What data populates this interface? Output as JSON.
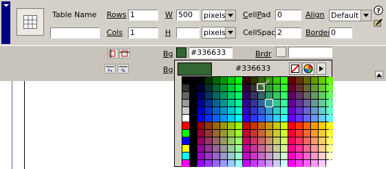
{
  "inspector": {
    "table_name_label": "Table Name",
    "table_name_value": "",
    "rows_label": "Rows",
    "rows_value": "1",
    "cols_label": "Cols",
    "cols_value": "1",
    "width_label": "W",
    "width_value": "500",
    "width_unit": "pixels",
    "height_label": "H",
    "height_value": "",
    "height_unit": "pixels",
    "cellpad_label": "CellPad",
    "cellpad_value": "0",
    "cellspace_label": "CellSpace",
    "cellspace_value": "2",
    "align_label": "Align",
    "align_value": "Default",
    "border_label": "Border",
    "border_value": "0",
    "bg_label": "Bg",
    "bg_value": "#336633",
    "bg_color": "#336633",
    "brdr_label": "Brdr",
    "brdr_value": "",
    "bg2_label": "Bg",
    "help_icon": "help-icon"
  },
  "color_picker": {
    "selected_hex": "#336633",
    "selected_color": "#336633",
    "default_color_icon": "no-color-icon",
    "system_color_icon": "color-wheel-icon",
    "menu_icon": "right-arrow-icon"
  },
  "colors": {
    "panel_bg": "#d4d0c8",
    "title_tab": "#000080",
    "accent_line": "#5a5aa0"
  }
}
